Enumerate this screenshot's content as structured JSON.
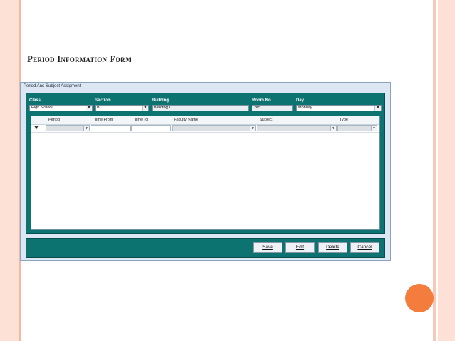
{
  "slide": {
    "title": "Period Information Form"
  },
  "window": {
    "title": "Period And Subject Assigment"
  },
  "fields": {
    "class": {
      "label": "Class",
      "value": "High School"
    },
    "section": {
      "label": "Section",
      "value": "B"
    },
    "building": {
      "label": "Building",
      "value": "Building1"
    },
    "room": {
      "label": "Room No.",
      "value": "205"
    },
    "day": {
      "label": "Day",
      "value": "Monday"
    }
  },
  "grid": {
    "columns": [
      "Period",
      "Time From",
      "Time To",
      "Faculty Name",
      "Subject",
      "Type"
    ],
    "new_row_marker": "✱"
  },
  "buttons": {
    "save": "Save",
    "edit": "Edit",
    "delete": "Delete",
    "cancel": "Cancel"
  },
  "colors": {
    "panel": "#0c7371",
    "accent_circle": "#f47c3c",
    "side_bars": "#fde1d7"
  }
}
